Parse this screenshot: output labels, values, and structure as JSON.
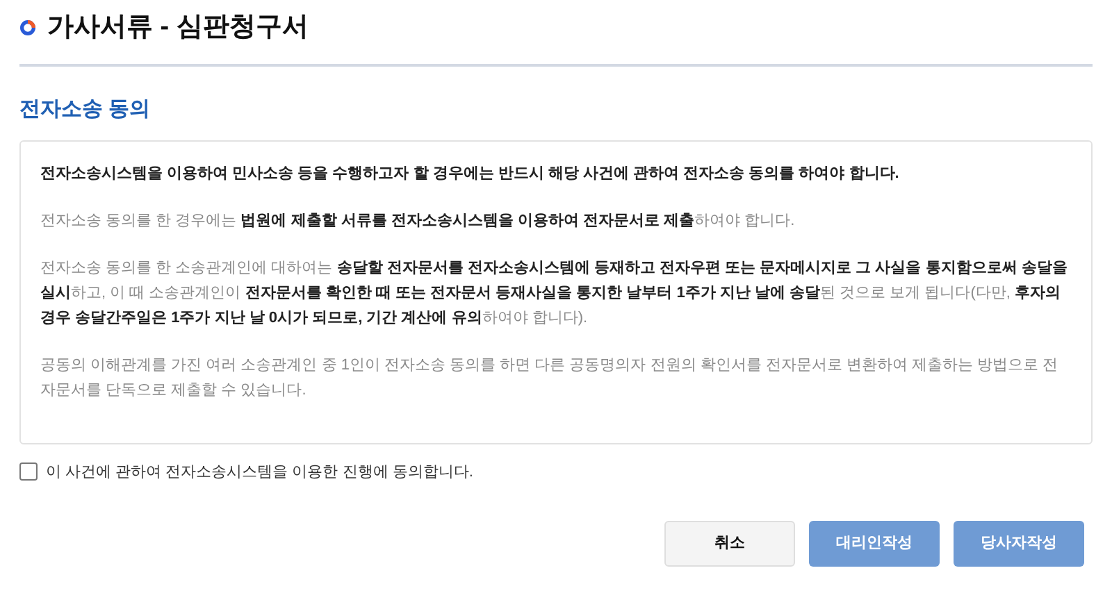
{
  "page_title": "가사서류 - 심판청구서",
  "section_title": "전자소송 동의",
  "paragraphs": [
    {
      "kind": "lead",
      "text": "전자소송시스템을 이용하여 민사소송 등을 수행하고자 할 경우에는 반드시 해당 사건에 관하여 전자소송 동의를 하여야 합니다."
    },
    {
      "kind": "body",
      "text": "전자소송 동의를 한 경우에는 **법원에 제출할 서류를 전자소송시스템을 이용하여 전자문서로 제출**하여야 합니다."
    },
    {
      "kind": "body",
      "text": "전자소송 동의를 한 소송관계인에 대하여는 **송달할 전자문서를 전자소송시스템에 등재하고 전자우편 또는 문자메시지로 그 사실을 통지함으로써 송달을 실시**하고, 이 때 소송관계인이 **전자문서를 확인한 때 또는 전자문서 등재사실을 통지한 날부터 1주가 지난 날에 송달**된 것으로 보게 됩니다(다만, **후자의 경우 송달간주일은 1주가 지난 날 0시가 되므로, 기간 계산에 유의**하여야 합니다)."
    },
    {
      "kind": "body",
      "text": "공동의 이해관계를 가진 여러 소송관계인 중 1인이 전자소송 동의를 하면 다른 공동명의자 전원의 확인서를 전자문서로 변환하여 제출하는 방법으로 전자문서를 단독으로 제출할 수 있습니다."
    }
  ],
  "consent": {
    "label": "이 사건에 관하여 전자소송시스템을 이용한 진행에 동의합니다.",
    "checked": false
  },
  "buttons": [
    {
      "kind": "secondary",
      "label": "취소"
    },
    {
      "kind": "primary",
      "label": "대리인작성"
    },
    {
      "kind": "primary",
      "label": "당사자작성"
    }
  ]
}
